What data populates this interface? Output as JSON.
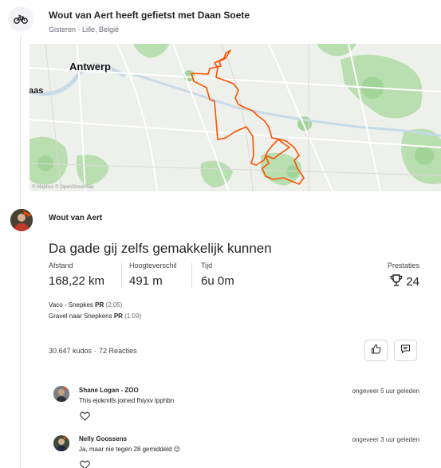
{
  "group": {
    "title": "Wout van Aert heeft gefietst met Daan Soete",
    "meta": "Gisteren · Lille, België",
    "icon": "bike-icon"
  },
  "map": {
    "city_label": "Antwerp",
    "partial_label": "laas",
    "route_color": "#fc5200",
    "copyright": "© Mapbox © OpenStreetMap"
  },
  "activity": {
    "athlete": "Wout van Aert",
    "title": "Da gade gij zelfs gemakkelijk kunnen",
    "stats": [
      {
        "label": "Afstand",
        "value": "168,22 km"
      },
      {
        "label": "Hoogteverschil",
        "value": "491 m"
      },
      {
        "label": "Tijd",
        "value": "6u 0m"
      }
    ],
    "achievements": {
      "label": "Prestaties",
      "value": "24",
      "icon": "trophy-icon"
    },
    "segments": [
      {
        "name": "Vaco - Snepkes",
        "badge": "PR",
        "time": "(2:05)"
      },
      {
        "name": "Gravel naar Snepkens",
        "badge": "PR",
        "time": "(1:09)"
      }
    ],
    "kudos": "30.647 kudos",
    "separator": "·",
    "reactions": "72 Reacties",
    "buttons": {
      "kudo": "thumbs-up-icon",
      "comment": "comment-icon"
    }
  },
  "comments": [
    {
      "name": "Shane Logan - ZOO",
      "text": "This ejokmlfs joined fhiyxv lpphbn",
      "time": "ongeveer 5 uur geleden"
    },
    {
      "name": "Nelly Goossens",
      "text": "Ja, maar nie tegen 28 gemiddeld 😉",
      "time": "ongeveer 3 uur geleden"
    }
  ]
}
